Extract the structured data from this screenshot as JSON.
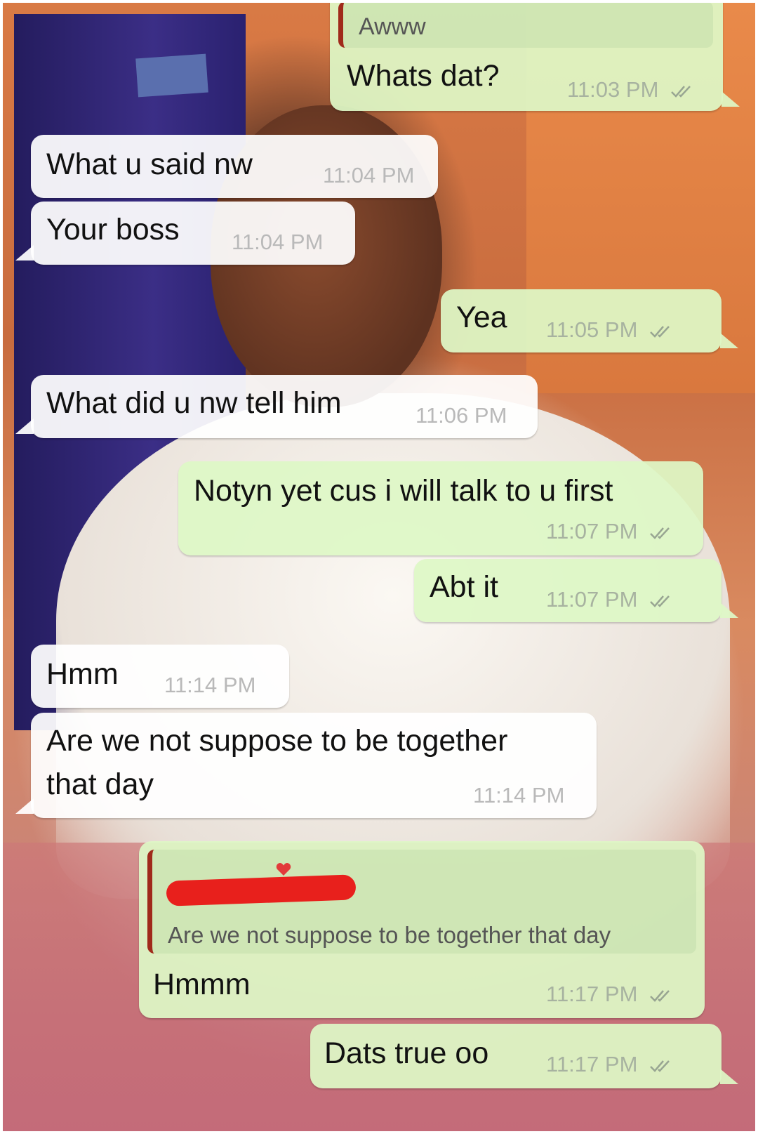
{
  "messages": [
    {
      "id": "m1",
      "dir": "out",
      "quote": "Awww",
      "text": "Whats dat?",
      "time": "11:03 PM",
      "ticks": true
    },
    {
      "id": "m2",
      "dir": "in",
      "text": "What u said nw",
      "time": "11:04 PM"
    },
    {
      "id": "m3",
      "dir": "in",
      "text": "Your boss",
      "time": "11:04 PM"
    },
    {
      "id": "m4",
      "dir": "out",
      "text": "Yea",
      "time": "11:05 PM",
      "ticks": true
    },
    {
      "id": "m5",
      "dir": "in",
      "text": "What did u nw tell him",
      "time": "11:06 PM"
    },
    {
      "id": "m6",
      "dir": "out",
      "text": "Notyn yet cus i will talk to u first",
      "time": "11:07 PM",
      "ticks": true
    },
    {
      "id": "m7",
      "dir": "out",
      "text": "Abt it",
      "time": "11:07 PM",
      "ticks": true
    },
    {
      "id": "m8",
      "dir": "in",
      "text": "Hmm",
      "time": "11:14 PM"
    },
    {
      "id": "m9",
      "dir": "in",
      "text_line1": "Are we not suppose to be together",
      "text_line2": "that day",
      "time": "11:14 PM"
    },
    {
      "id": "m10",
      "dir": "out",
      "quote": "Are we not suppose to be together that day",
      "text": "Hmmm",
      "time": "11:17 PM",
      "ticks": true
    },
    {
      "id": "m11",
      "dir": "out",
      "text": "Dats true oo",
      "time": "11:17 PM",
      "ticks": true
    }
  ],
  "colors": {
    "incoming_bubble": "#ffffff",
    "outgoing_bubble": "#def8c6",
    "quote_bar": "#a02a1b",
    "redaction": "#e8201c"
  },
  "icons": {
    "read_receipt": "double-check-icon"
  }
}
